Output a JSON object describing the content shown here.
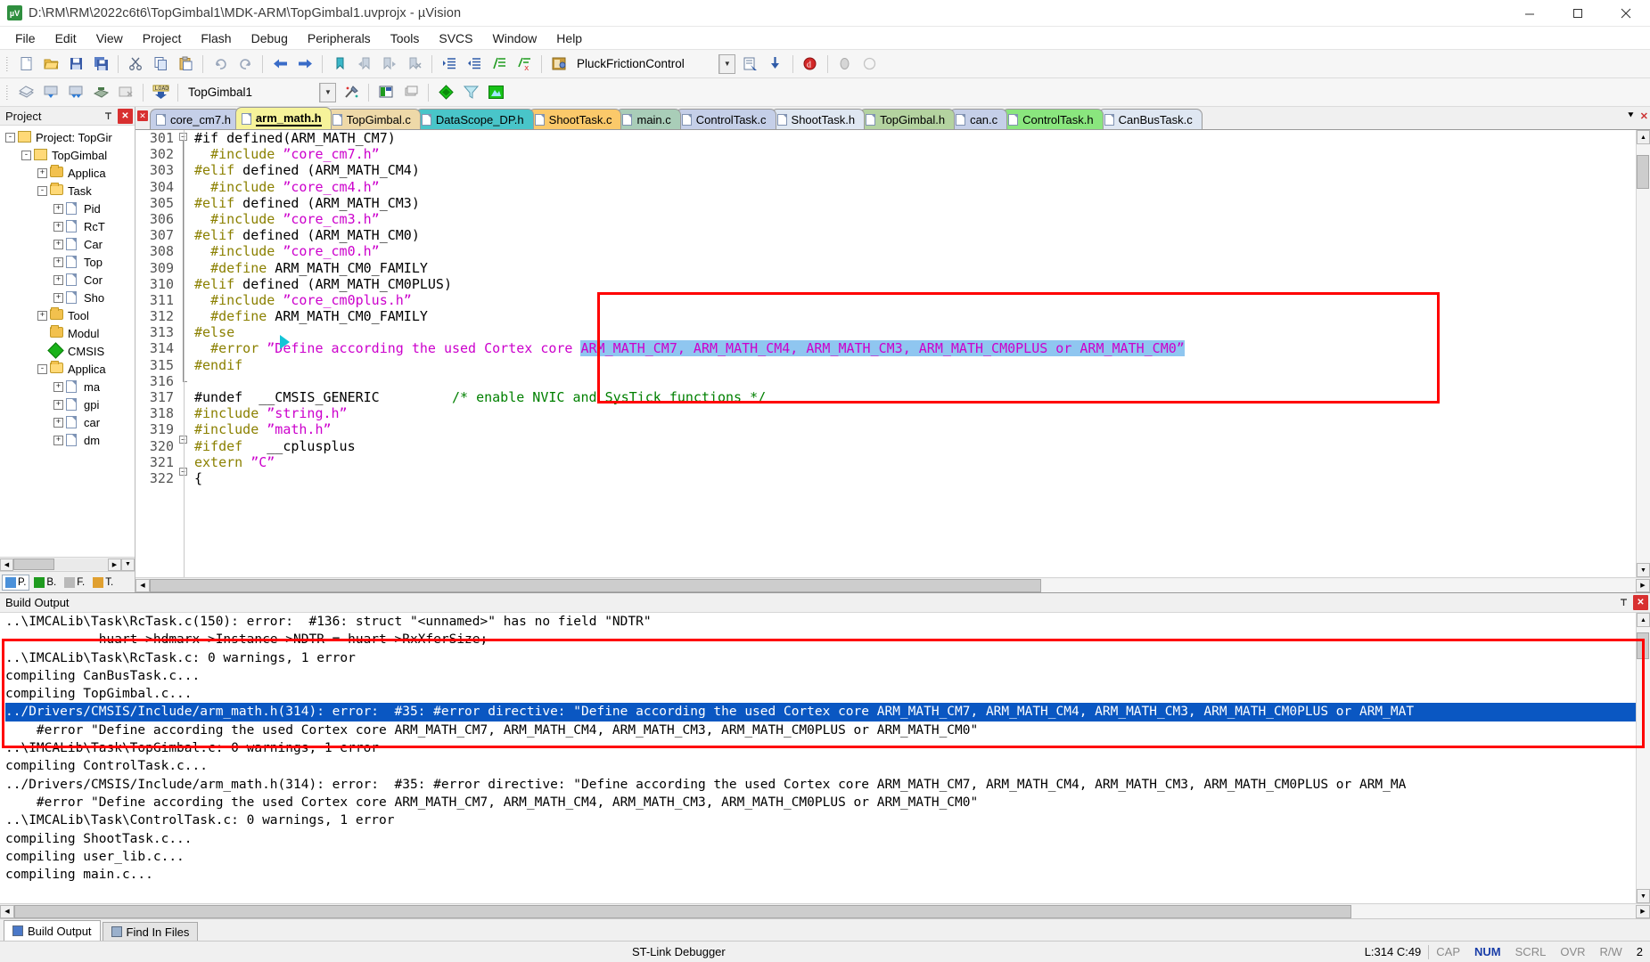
{
  "window": {
    "title": "D:\\RM\\RM\\2022c6t6\\TopGimbal1\\MDK-ARM\\TopGimbal1.uvprojx - µVision",
    "app_icon": "uvision-icon",
    "minimize": "minimize-button",
    "maximize": "maximize-button",
    "close": "close-button"
  },
  "menu": [
    "File",
    "Edit",
    "View",
    "Project",
    "Flash",
    "Debug",
    "Peripherals",
    "Tools",
    "SVCS",
    "Window",
    "Help"
  ],
  "toolbar1": {
    "target_combo_value": "PluckFrictionControl",
    "buttons": [
      "new-file-icon",
      "open-file-icon",
      "save-icon",
      "save-all-icon",
      "cut-icon",
      "copy-icon",
      "paste-icon",
      "undo-icon",
      "redo-icon",
      "navigate-back-icon",
      "navigate-forward-icon",
      "bookmark-toggle-icon",
      "bookmark-prev-icon",
      "bookmark-next-icon",
      "bookmark-clear-icon",
      "indent-icon",
      "outdent-icon",
      "comment-icon",
      "uncomment-icon",
      "target-options-icon"
    ],
    "right_buttons": [
      "build-target-icon",
      "download-icon",
      "debug-session-icon",
      "start-stop-icon",
      "reset-icon"
    ]
  },
  "toolbar2": {
    "project_combo_value": "TopGimbal1",
    "buttons": [
      "build-icon",
      "rebuild-icon",
      "batch-build-icon",
      "translate-icon",
      "stop-build-icon",
      "load-icon"
    ],
    "right_buttons": [
      "manage-project-icon",
      "configure-icon",
      "books-icon",
      "functions-icon",
      "templates-icon",
      "source-browser-icon"
    ]
  },
  "project_panel": {
    "header": "Project",
    "pin": "pin-icon",
    "close": "close-icon",
    "tree": [
      {
        "depth": 0,
        "toggle": "-",
        "icon": "project-icon",
        "label": "Project: TopGir"
      },
      {
        "depth": 1,
        "toggle": "-",
        "icon": "target-icon",
        "label": "TopGimbal"
      },
      {
        "depth": 2,
        "toggle": "+",
        "icon": "folder-icon",
        "label": "Applica"
      },
      {
        "depth": 2,
        "toggle": "-",
        "icon": "folder-open-icon",
        "label": "Task"
      },
      {
        "depth": 3,
        "toggle": "+",
        "icon": "file-icon",
        "label": "Pid"
      },
      {
        "depth": 3,
        "toggle": "+",
        "icon": "file-icon",
        "label": "RcT"
      },
      {
        "depth": 3,
        "toggle": "+",
        "icon": "file-icon",
        "label": "Car"
      },
      {
        "depth": 3,
        "toggle": "+",
        "icon": "file-icon",
        "label": "Top"
      },
      {
        "depth": 3,
        "toggle": "+",
        "icon": "file-icon",
        "label": "Cor"
      },
      {
        "depth": 3,
        "toggle": "+",
        "icon": "file-icon",
        "label": "Sho"
      },
      {
        "depth": 2,
        "toggle": "+",
        "icon": "folder-icon",
        "label": "Tool"
      },
      {
        "depth": 2,
        "toggle": "",
        "icon": "folder-icon",
        "label": "Modul"
      },
      {
        "depth": 2,
        "toggle": "",
        "icon": "cmsis-icon",
        "label": "CMSIS"
      },
      {
        "depth": 2,
        "toggle": "-",
        "icon": "folder-open-icon",
        "label": "Applica"
      },
      {
        "depth": 3,
        "toggle": "+",
        "icon": "file-icon",
        "label": "ma"
      },
      {
        "depth": 3,
        "toggle": "+",
        "icon": "file-icon",
        "label": "gpi"
      },
      {
        "depth": 3,
        "toggle": "+",
        "icon": "file-icon",
        "label": "car"
      },
      {
        "depth": 3,
        "toggle": "+",
        "icon": "file-icon",
        "label": "dm"
      }
    ],
    "tabs": [
      {
        "label": "P.",
        "icon": "project-tab-icon",
        "active": true
      },
      {
        "label": "B.",
        "icon": "books-tab-icon",
        "active": false
      },
      {
        "label": "F.",
        "icon": "functions-tab-icon",
        "active": false
      },
      {
        "label": "T.",
        "icon": "templates-tab-icon",
        "active": false
      }
    ]
  },
  "editor": {
    "tabs": [
      {
        "label": "core_cm7.h",
        "color": "#c5cfe8",
        "active": false
      },
      {
        "label": "arm_math.h",
        "color": "#f6f39a",
        "active": true
      },
      {
        "label": "TopGimbal.c",
        "color": "#eed9a8",
        "active": false
      },
      {
        "label": "DataScope_DP.h",
        "color": "#49c5c9",
        "active": false
      },
      {
        "label": "ShootTask.c",
        "color": "#fbc96a",
        "active": false
      },
      {
        "label": "main.c",
        "color": "#a9cdb8",
        "active": false
      },
      {
        "label": "ControlTask.c",
        "color": "#c5cfe8",
        "active": false
      },
      {
        "label": "ShootTask.h",
        "color": "#dfe7f2",
        "active": false
      },
      {
        "label": "TopGimbal.h",
        "color": "#b4d3a0",
        "active": false
      },
      {
        "label": "can.c",
        "color": "#c5cfe8",
        "active": false
      },
      {
        "label": "ControlTask.h",
        "color": "#8ae67e",
        "active": false
      },
      {
        "label": "CanBusTask.c",
        "color": "#dfe7f2",
        "active": false
      }
    ],
    "tab_overflow_icon": "tab-list-icon",
    "tab_close_icon": "tab-close-icon",
    "first_line_number": 301,
    "lines": [
      {
        "n": 301,
        "fold": "minus",
        "tokens": [
          {
            "t": "#if defined(ARM_MATH_CM7)",
            "c": "pln"
          }
        ]
      },
      {
        "n": 302,
        "tokens": [
          {
            "t": "  ",
            "c": "pln"
          },
          {
            "t": "#include ",
            "c": "kw"
          },
          {
            "t": "”core_cm7.h”",
            "c": "str"
          }
        ]
      },
      {
        "n": 303,
        "tokens": [
          {
            "t": "#elif",
            "c": "kw"
          },
          {
            "t": " defined (ARM_MATH_CM4)",
            "c": "pln"
          }
        ]
      },
      {
        "n": 304,
        "tokens": [
          {
            "t": "  ",
            "c": "pln"
          },
          {
            "t": "#include ",
            "c": "kw"
          },
          {
            "t": "”core_cm4.h”",
            "c": "str"
          }
        ]
      },
      {
        "n": 305,
        "tokens": [
          {
            "t": "#elif",
            "c": "kw"
          },
          {
            "t": " defined (ARM_MATH_CM3)",
            "c": "pln"
          }
        ]
      },
      {
        "n": 306,
        "tokens": [
          {
            "t": "  ",
            "c": "pln"
          },
          {
            "t": "#include ",
            "c": "kw"
          },
          {
            "t": "”core_cm3.h”",
            "c": "str"
          }
        ]
      },
      {
        "n": 307,
        "tokens": [
          {
            "t": "#elif",
            "c": "kw"
          },
          {
            "t": " defined (ARM_MATH_CM0)",
            "c": "pln"
          }
        ]
      },
      {
        "n": 308,
        "tokens": [
          {
            "t": "  ",
            "c": "pln"
          },
          {
            "t": "#include ",
            "c": "kw"
          },
          {
            "t": "”core_cm0.h”",
            "c": "str"
          }
        ]
      },
      {
        "n": 309,
        "tokens": [
          {
            "t": "  ",
            "c": "pln"
          },
          {
            "t": "#define",
            "c": "kw"
          },
          {
            "t": " ARM_MATH_CM0_FAMILY",
            "c": "pln"
          }
        ]
      },
      {
        "n": 310,
        "tokens": [
          {
            "t": "#elif",
            "c": "kw"
          },
          {
            "t": " defined (ARM_MATH_CM0PLUS)",
            "c": "pln"
          }
        ]
      },
      {
        "n": 311,
        "tokens": [
          {
            "t": "  ",
            "c": "pln"
          },
          {
            "t": "#include ",
            "c": "kw"
          },
          {
            "t": "”core_cm0plus.h”",
            "c": "str"
          }
        ]
      },
      {
        "n": 312,
        "tokens": [
          {
            "t": "  ",
            "c": "pln"
          },
          {
            "t": "#define",
            "c": "kw"
          },
          {
            "t": " ARM_MATH_CM0_FAMILY",
            "c": "pln"
          }
        ]
      },
      {
        "n": 313,
        "tokens": [
          {
            "t": "#else",
            "c": "kw"
          }
        ]
      },
      {
        "n": 314,
        "marker": true,
        "tokens": [
          {
            "t": "  ",
            "c": "pln"
          },
          {
            "t": "#error ",
            "c": "kw"
          },
          {
            "t": "”Define according the used Cortex core ",
            "c": "str"
          },
          {
            "t": "ARM_MATH_CM7, ARM_MATH_CM4, ARM_MATH_CM3, ARM_MATH_CM0PLUS or ARM_MATH_CM0”",
            "c": "str sel"
          }
        ]
      },
      {
        "n": 315,
        "tokens": [
          {
            "t": "#endif",
            "c": "kw"
          }
        ]
      },
      {
        "n": 316,
        "fold": "end",
        "tokens": [
          {
            "t": "",
            "c": "pln"
          }
        ]
      },
      {
        "n": 317,
        "tokens": [
          {
            "t": "#undef  __CMSIS_GENERIC         ",
            "c": "pln"
          },
          {
            "t": "/* enable NVIC and SysTick functions */",
            "c": "cmt"
          }
        ]
      },
      {
        "n": 318,
        "tokens": [
          {
            "t": "#include ",
            "c": "kw"
          },
          {
            "t": "”string.h”",
            "c": "str"
          }
        ]
      },
      {
        "n": 319,
        "tokens": [
          {
            "t": "#include ",
            "c": "kw"
          },
          {
            "t": "”math.h”",
            "c": "str"
          }
        ]
      },
      {
        "n": 320,
        "fold": "minus",
        "tokens": [
          {
            "t": "#ifdef",
            "c": "kw"
          },
          {
            "t": "   __cplusplus",
            "c": "pln"
          }
        ]
      },
      {
        "n": 321,
        "tokens": [
          {
            "t": "extern ",
            "c": "kw"
          },
          {
            "t": "”C”",
            "c": "str"
          }
        ]
      },
      {
        "n": 322,
        "fold": "minus",
        "tokens": [
          {
            "t": "{",
            "c": "pln"
          }
        ]
      }
    ]
  },
  "build_output": {
    "header": "Build Output",
    "pin": "pin-icon",
    "close": "close-icon",
    "lines": [
      {
        "text": "..\\IMCALib\\Task\\RcTask.c(150): error:  #136: struct \"<unnamed>\" has no field \"NDTR\"",
        "hl": false
      },
      {
        "text": "            huart->hdmarx->Instance->NDTR = huart->RxXferSize;",
        "hl": false
      },
      {
        "text": "..\\IMCALib\\Task\\RcTask.c: 0 warnings, 1 error",
        "hl": false
      },
      {
        "text": "compiling CanBusTask.c...",
        "hl": false
      },
      {
        "text": "compiling TopGimbal.c...",
        "hl": false
      },
      {
        "text": "../Drivers/CMSIS/Include/arm_math.h(314): error:  #35: #error directive: \"Define according the used Cortex core ARM_MATH_CM7, ARM_MATH_CM4, ARM_MATH_CM3, ARM_MATH_CM0PLUS or ARM_MAT",
        "hl": true
      },
      {
        "text": "    #error \"Define according the used Cortex core ARM_MATH_CM7, ARM_MATH_CM4, ARM_MATH_CM3, ARM_MATH_CM0PLUS or ARM_MATH_CM0\"",
        "hl": false
      },
      {
        "text": "..\\IMCALib\\Task\\TopGimbal.c: 0 warnings, 1 error",
        "hl": false
      },
      {
        "text": "compiling ControlTask.c...",
        "hl": false
      },
      {
        "text": "../Drivers/CMSIS/Include/arm_math.h(314): error:  #35: #error directive: \"Define according the used Cortex core ARM_MATH_CM7, ARM_MATH_CM4, ARM_MATH_CM3, ARM_MATH_CM0PLUS or ARM_MA",
        "hl": false
      },
      {
        "text": "    #error \"Define according the used Cortex core ARM_MATH_CM7, ARM_MATH_CM4, ARM_MATH_CM3, ARM_MATH_CM0PLUS or ARM_MATH_CM0\"",
        "hl": false
      },
      {
        "text": "..\\IMCALib\\Task\\ControlTask.c: 0 warnings, 1 error",
        "hl": false
      },
      {
        "text": "compiling ShootTask.c...",
        "hl": false
      },
      {
        "text": "compiling user_lib.c...",
        "hl": false
      },
      {
        "text": "compiling main.c...",
        "hl": false
      }
    ]
  },
  "bottom_tabs": [
    {
      "label": "Build Output",
      "icon": "build-output-icon",
      "active": true
    },
    {
      "label": "Find In Files",
      "icon": "find-in-files-icon",
      "active": false
    }
  ],
  "statusbar": {
    "debugger": "ST-Link Debugger",
    "position": "L:314 C:49",
    "caps": "CAP",
    "num": "NUM",
    "scrl": "SCRL",
    "ovr": "OVR",
    "rw": "R/W",
    "overflow": "2"
  },
  "colors": {
    "accent_red": "#ff0000",
    "selection_blue": "#8fc6f0",
    "build_highlight_blue": "#0a57c2",
    "keyword": "#8b8000",
    "string": "#cc00cc",
    "comment": "#008000"
  }
}
